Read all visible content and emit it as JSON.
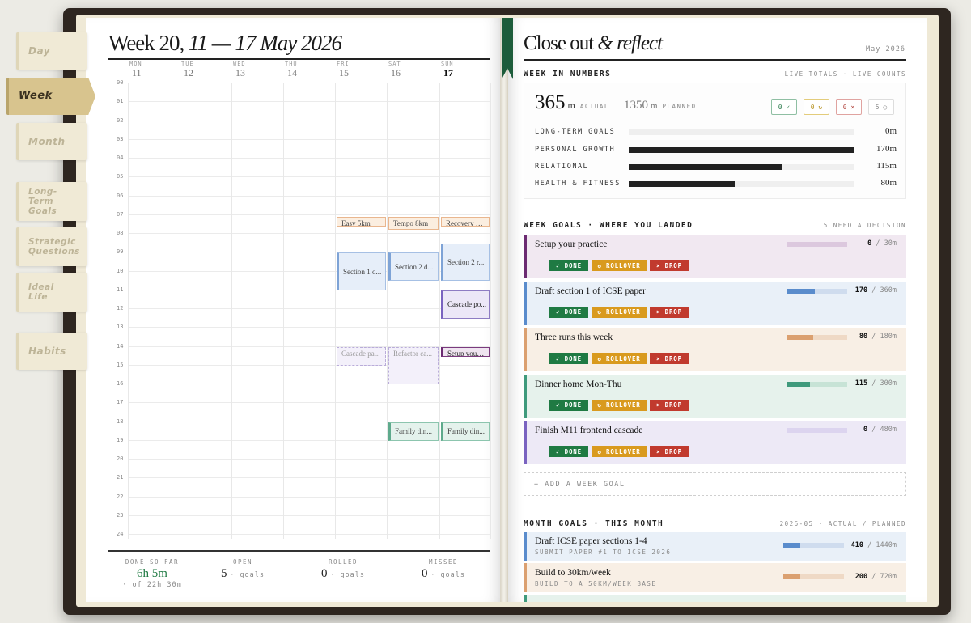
{
  "tabs": [
    {
      "label": "Day",
      "lines": [
        "Day"
      ],
      "active": false
    },
    {
      "label": "Week",
      "lines": [
        "Week"
      ],
      "active": true
    },
    {
      "label": "Month",
      "lines": [
        "Month"
      ],
      "active": false
    },
    {
      "label": "Long-Term Goals",
      "lines": [
        "Long-",
        "Term",
        "Goals"
      ],
      "active": false
    },
    {
      "label": "Strategic Questions",
      "lines": [
        "Strategic",
        "Questions"
      ],
      "active": false
    },
    {
      "label": "Ideal Life",
      "lines": [
        "Ideal",
        "Life"
      ],
      "active": false
    },
    {
      "label": "Habits",
      "lines": [
        "Habits"
      ],
      "active": false
    }
  ],
  "week": {
    "title_prefix": "Week 20, ",
    "title_range": "11 — 17 May 2026",
    "days": [
      {
        "name": "MON",
        "date": "11",
        "today": false
      },
      {
        "name": "TUE",
        "date": "12",
        "today": false
      },
      {
        "name": "WED",
        "date": "13",
        "today": false
      },
      {
        "name": "THU",
        "date": "14",
        "today": false
      },
      {
        "name": "FRI",
        "date": "15",
        "today": false
      },
      {
        "name": "SAT",
        "date": "16",
        "today": false
      },
      {
        "name": "SUN",
        "date": "17",
        "today": true
      }
    ],
    "hours": [
      "00",
      "01",
      "02",
      "03",
      "04",
      "05",
      "06",
      "07",
      "08",
      "09",
      "10",
      "11",
      "12",
      "13",
      "14",
      "15",
      "16",
      "17",
      "18",
      "19",
      "20",
      "21",
      "22",
      "23",
      "24"
    ],
    "events": [
      {
        "day": 4,
        "start": 7.1,
        "end": 7.6,
        "label": "Easy 5km",
        "kind": "run"
      },
      {
        "day": 5,
        "start": 7.1,
        "end": 7.8,
        "label": "Tempo 8km",
        "kind": "run"
      },
      {
        "day": 6,
        "start": 7.1,
        "end": 7.6,
        "label": "Recovery jog",
        "kind": "run"
      },
      {
        "day": 4,
        "start": 9.0,
        "end": 11.0,
        "label": "Section 1 d...",
        "kind": "study"
      },
      {
        "day": 5,
        "start": 9.0,
        "end": 10.5,
        "label": "Section 2 d...",
        "kind": "study"
      },
      {
        "day": 6,
        "start": 8.5,
        "end": 10.5,
        "label": "Section 2 r...",
        "kind": "study"
      },
      {
        "day": 6,
        "start": 11.0,
        "end": 12.5,
        "label": "Cascade po...",
        "kind": "cascade"
      },
      {
        "day": 6,
        "start": 14.0,
        "end": 14.5,
        "label": "Setup your ...",
        "kind": "setup"
      },
      {
        "day": 4,
        "start": 14.0,
        "end": 15.0,
        "label": "Cascade pa...",
        "kind": "dash"
      },
      {
        "day": 5,
        "start": 14.0,
        "end": 16.0,
        "label": "Refactor ca...",
        "kind": "dash"
      },
      {
        "day": 5,
        "start": 18.0,
        "end": 19.0,
        "label": "Family din...",
        "kind": "family"
      },
      {
        "day": 6,
        "start": 18.0,
        "end": 19.0,
        "label": "Family din...",
        "kind": "family"
      }
    ],
    "footer": [
      {
        "label": "DONE SO FAR",
        "value": "6h 5m",
        "unit": "",
        "sub": "· of 22h 30m"
      },
      {
        "label": "OPEN",
        "value": "5",
        "unit": "· goals",
        "sub": ""
      },
      {
        "label": "ROLLED",
        "value": "0",
        "unit": "· goals",
        "sub": ""
      },
      {
        "label": "MISSED",
        "value": "0",
        "unit": "· goals",
        "sub": ""
      }
    ]
  },
  "reflect": {
    "title_prefix": "Close out ",
    "title_italic": "& reflect",
    "date": "May 2026",
    "numbers": {
      "heading": "WEEK IN NUMBERS",
      "meta": "LIVE TOTALS · LIVE COUNTS",
      "actual": "365",
      "actual_unit": "m",
      "actual_label": "ACTUAL",
      "planned": "1350",
      "planned_unit": "m",
      "planned_label": "PLANNED",
      "counts": [
        "0 ✓",
        "0 ↻",
        "0 ×",
        "5 ○"
      ],
      "categories": [
        {
          "name": "LONG-TERM GOALS",
          "value": "0m",
          "fraction": 0.0
        },
        {
          "name": "PERSONAL GROWTH",
          "value": "170m",
          "fraction": 1.0
        },
        {
          "name": "RELATIONAL",
          "value": "115m",
          "fraction": 0.68
        },
        {
          "name": "HEALTH & FITNESS",
          "value": "80m",
          "fraction": 0.47
        }
      ]
    },
    "week_goals": {
      "heading": "WEEK GOALS · WHERE YOU LANDED",
      "meta": "5 NEED A DECISION",
      "buttons": {
        "done": "✓ DONE",
        "rollover": "↻ ROLLOVER",
        "drop": "× DROP"
      },
      "items": [
        {
          "name": "Setup your practice",
          "actual": "0",
          "planned": "/ 30m",
          "fraction": 0.0,
          "color": "#6c2b72",
          "bg": "#f1e8f1",
          "track": "#dcc8de"
        },
        {
          "name": "Draft section 1 of ICSE paper",
          "actual": "170",
          "planned": "/ 360m",
          "fraction": 0.47,
          "color": "#5a8ccc",
          "bg": "#e9f0f8",
          "track": "#cfdcee"
        },
        {
          "name": "Three runs this week",
          "actual": "80",
          "planned": "/ 180m",
          "fraction": 0.44,
          "color": "#dba070",
          "bg": "#f8efe5",
          "track": "#efd9c5"
        },
        {
          "name": "Dinner home Mon-Thu",
          "actual": "115",
          "planned": "/ 300m",
          "fraction": 0.38,
          "color": "#3f9a7c",
          "bg": "#e6f2ec",
          "track": "#c7e3d6"
        },
        {
          "name": "Finish M11 frontend cascade",
          "actual": "0",
          "planned": "/ 480m",
          "fraction": 0.0,
          "color": "#7a63c0",
          "bg": "#ede9f6",
          "track": "#dcd4ef"
        }
      ],
      "add_label": "+ ADD A WEEK GOAL"
    },
    "month_goals": {
      "heading": "MONTH GOALS · THIS MONTH",
      "meta": "2026-05 · ACTUAL / PLANNED",
      "items": [
        {
          "name": "Draft ICSE paper sections 1-4",
          "sub": "SUBMIT PAPER #1 TO ICSE 2026",
          "actual": "410",
          "planned": "/ 1440m",
          "fraction": 0.28,
          "color": "#5a8ccc",
          "bg": "#e9f0f8",
          "track": "#cfdcee"
        },
        {
          "name": "Build to 30km/week",
          "sub": "BUILD TO A 50KM/WEEK BASE",
          "actual": "200",
          "planned": "/ 720m",
          "fraction": 0.28,
          "color": "#dba070",
          "bg": "#f8efe5",
          "track": "#efd9c5"
        }
      ],
      "partial_color": "#3f9a7c",
      "partial_bg": "#e6f2ec"
    }
  }
}
